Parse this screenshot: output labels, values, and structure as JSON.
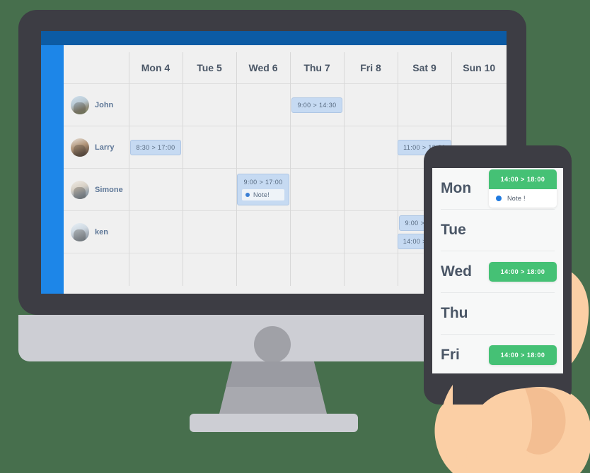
{
  "scene": {
    "background_color": "#476f4d",
    "devices": [
      "desktop-monitor",
      "mobile-phone",
      "hand"
    ]
  },
  "desktop": {
    "topbar_color": "#0c5ba4",
    "sidebar_color": "#1d86e8",
    "calendar": {
      "name_column_header": "",
      "columns": [
        "Mon 4",
        "Tue 5",
        "Wed 6",
        "Thu 7",
        "Fri 8",
        "Sat 9",
        "Sun 10"
      ],
      "rows": [
        {
          "person": "John",
          "avatar": "avatar-john",
          "events": {
            "Thu 7": [
              {
                "time": "9:00 > 14:30",
                "note": null
              }
            ]
          }
        },
        {
          "person": "Larry",
          "avatar": "avatar-larry",
          "events": {
            "Mon 4": [
              {
                "time": "8:30 > 17:00",
                "note": null
              }
            ],
            "Sat 9": [
              {
                "time": "11:00 > 18:30",
                "note": null
              }
            ]
          }
        },
        {
          "person": "Simone",
          "avatar": "avatar-simone",
          "events": {
            "Wed 6": [
              {
                "time": "9:00 > 17:00",
                "note": "Note!"
              }
            ]
          }
        },
        {
          "person": "ken",
          "avatar": "avatar-ken",
          "events": {
            "Sat 9": [
              {
                "time": "9:00 > 18:00",
                "note": null
              },
              {
                "time": "14:00 > 18:00",
                "note": null
              }
            ]
          }
        }
      ],
      "chip_bg_color": "#c6daf2",
      "chip_border_color": "#aec6e4",
      "chip_text_color": "#56697f",
      "note_dot_color": "#3b7fd4"
    }
  },
  "mobile": {
    "chip_color": "#45c175",
    "note_dot_color": "#1f7ae0",
    "days": [
      {
        "label": "Mon",
        "event": {
          "time": "14:00 > 18:00",
          "note": "Note !"
        }
      },
      {
        "label": "Tue",
        "event": null
      },
      {
        "label": "Wed",
        "event": {
          "time": "14:00 > 18:00",
          "note": null
        }
      },
      {
        "label": "Thu",
        "event": null
      },
      {
        "label": "Fri",
        "event": {
          "time": "14:00 > 18:00",
          "note": null
        }
      }
    ]
  }
}
